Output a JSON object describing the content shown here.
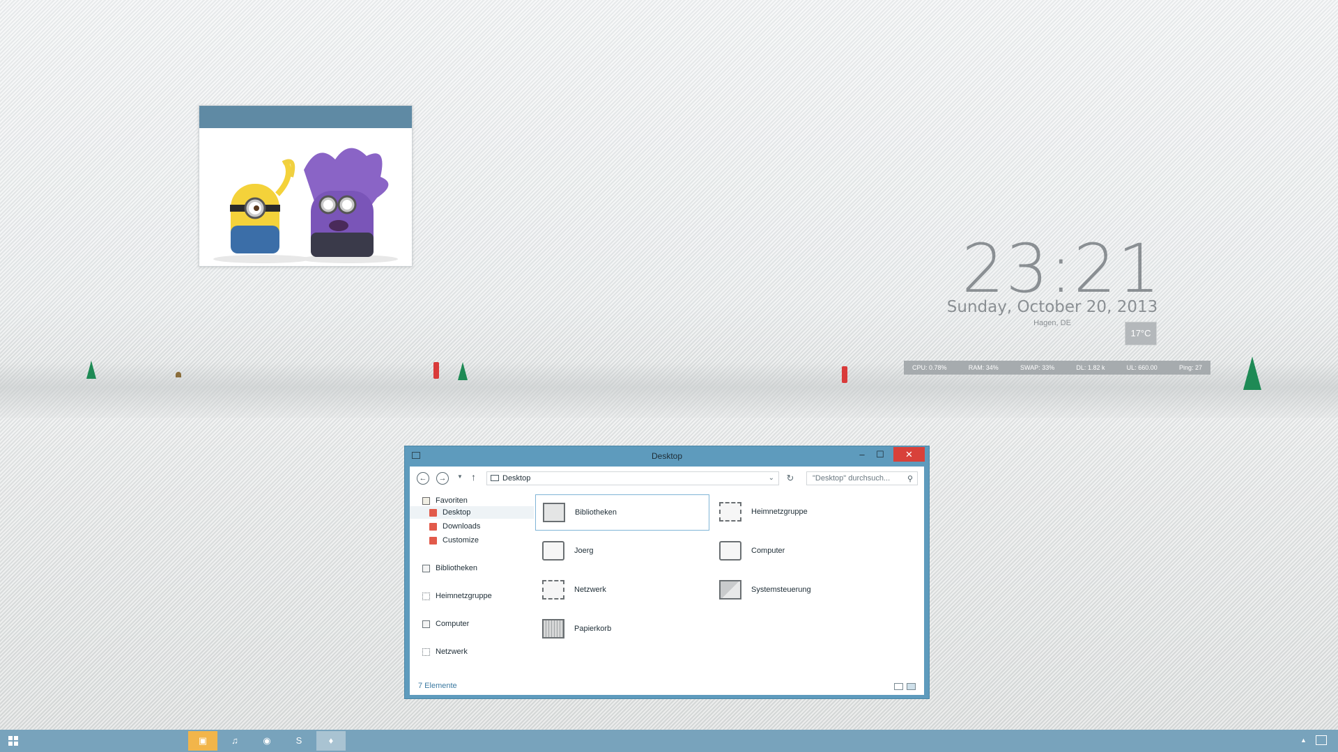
{
  "clock": {
    "time": "23:21",
    "date": "Sunday, October 20, 2013",
    "location": "Hagen, DE",
    "temperature": "17°C"
  },
  "stats": [
    {
      "label": "CPU:",
      "value": "0.78%"
    },
    {
      "label": "RAM:",
      "value": "34%"
    },
    {
      "label": "SWAP:",
      "value": "33%"
    },
    {
      "label": "DL:",
      "value": "1.82 k"
    },
    {
      "label": "UL:",
      "value": "660.00"
    },
    {
      "label": "Ping:",
      "value": "27"
    }
  ],
  "explorer": {
    "title": "Desktop",
    "controls": {
      "minimize": "–",
      "maximize": "☐",
      "close": "✕"
    },
    "address": "Desktop",
    "search_placeholder": "\"Desktop\" durchsuch...",
    "sidebar": {
      "favorites": "Favoriten",
      "desktop": "Desktop",
      "downloads": "Downloads",
      "customize": "Customize",
      "libraries": "Bibliotheken",
      "homegroup": "Heimnetzgruppe",
      "computer": "Computer",
      "network": "Netzwerk"
    },
    "items": [
      {
        "label": "Bibliotheken",
        "icon": "library-icon"
      },
      {
        "label": "Heimnetzgruppe",
        "icon": "homegroup-icon"
      },
      {
        "label": "Joerg",
        "icon": "user-folder-icon"
      },
      {
        "label": "Computer",
        "icon": "computer-icon"
      },
      {
        "label": "Netzwerk",
        "icon": "network-icon"
      },
      {
        "label": "Systemsteuerung",
        "icon": "control-panel-icon"
      },
      {
        "label": "Papierkorb",
        "icon": "recycle-bin-icon"
      }
    ],
    "status": "7 Elemente"
  },
  "taskbar": {
    "apps": [
      {
        "name": "file-explorer-icon",
        "glyph": "▣"
      },
      {
        "name": "music-player-icon",
        "glyph": "♫"
      },
      {
        "name": "firefox-icon",
        "glyph": "◉"
      },
      {
        "name": "skype-icon",
        "glyph": "S"
      },
      {
        "name": "droplet-icon",
        "glyph": "♦"
      }
    ],
    "tray_arrow": "▲"
  }
}
